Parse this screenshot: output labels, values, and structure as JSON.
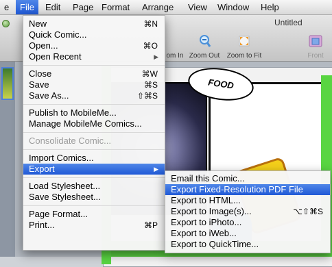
{
  "menubar": {
    "partial_left": "e",
    "items": [
      "File",
      "Edit",
      "Page",
      "Format",
      "Arrange",
      "View",
      "Window",
      "Help"
    ],
    "active_index": 0
  },
  "window": {
    "title": "Untitled",
    "toolbar": {
      "zoom_in": "om In",
      "zoom_out": "Zoom Out",
      "zoom_to_fit": "Zoom to Fit",
      "front": "Front"
    },
    "comic": {
      "bubble_text": "FOOD"
    }
  },
  "file_menu": {
    "items": [
      {
        "label": "New",
        "shortcut": "⌘N"
      },
      {
        "label": "Quick Comic...",
        "shortcut": ""
      },
      {
        "label": "Open...",
        "shortcut": "⌘O"
      },
      {
        "label": "Open Recent",
        "shortcut": "",
        "submenu": true
      },
      {
        "sep": true
      },
      {
        "label": "Close",
        "shortcut": "⌘W"
      },
      {
        "label": "Save",
        "shortcut": "⌘S"
      },
      {
        "label": "Save As...",
        "shortcut": "⇧⌘S"
      },
      {
        "sep": true
      },
      {
        "label": "Publish to MobileMe...",
        "shortcut": ""
      },
      {
        "label": "Manage MobileMe Comics...",
        "shortcut": ""
      },
      {
        "sep": true
      },
      {
        "label": "Consolidate Comic...",
        "shortcut": "",
        "disabled": true
      },
      {
        "sep": true
      },
      {
        "label": "Import Comics...",
        "shortcut": ""
      },
      {
        "label": "Export",
        "shortcut": "",
        "submenu": true,
        "highlighted": true
      },
      {
        "sep": true
      },
      {
        "label": "Load Stylesheet...",
        "shortcut": ""
      },
      {
        "label": "Save Stylesheet...",
        "shortcut": ""
      },
      {
        "sep": true
      },
      {
        "label": "Page Format...",
        "shortcut": ""
      },
      {
        "label": "Print...",
        "shortcut": "⌘P"
      }
    ]
  },
  "export_submenu": {
    "items": [
      {
        "label": "Email this Comic...",
        "shortcut": ""
      },
      {
        "label": "Export Fixed-Resolution PDF File",
        "shortcut": "",
        "highlighted": true
      },
      {
        "label": "Export to HTML...",
        "shortcut": ""
      },
      {
        "label": "Export to Image(s)...",
        "shortcut": "⌥⇧⌘S"
      },
      {
        "label": "Export to iPhoto...",
        "shortcut": ""
      },
      {
        "label": "Export to iWeb...",
        "shortcut": ""
      },
      {
        "label": "Export to QuickTime...",
        "shortcut": ""
      }
    ]
  },
  "colors": {
    "highlight": "#2f6be0",
    "comic_green": "#59d542"
  }
}
